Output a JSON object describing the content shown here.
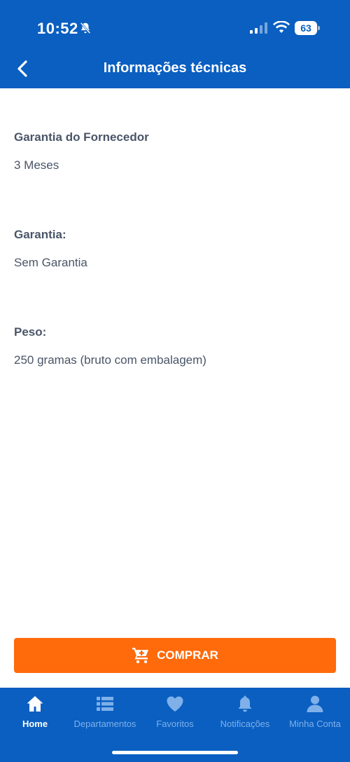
{
  "status_bar": {
    "time": "10:52",
    "battery": "63"
  },
  "header": {
    "title": "Informações técnicas"
  },
  "specs": [
    {
      "label": "Garantia do Fornecedor",
      "value": "3 Meses"
    },
    {
      "label": "Garantia:",
      "value": "Sem Garantia"
    },
    {
      "label": "Peso:",
      "value": "250 gramas (bruto com embalagem)"
    }
  ],
  "buy_button": {
    "label": "COMPRAR"
  },
  "tabbar": {
    "items": [
      {
        "label": "Home",
        "icon": "home-icon",
        "active": true
      },
      {
        "label": "Departamentos",
        "icon": "list-icon",
        "active": false
      },
      {
        "label": "Favoritos",
        "icon": "heart-icon",
        "active": false
      },
      {
        "label": "Notificações",
        "icon": "bell-icon",
        "active": false
      },
      {
        "label": "Minha Conta",
        "icon": "user-icon",
        "active": false
      }
    ]
  },
  "colors": {
    "brand_blue": "#0a5fc1",
    "accent_orange": "#ff6a0a",
    "tab_inactive": "#7fb0ea",
    "text": "#4a5568"
  }
}
